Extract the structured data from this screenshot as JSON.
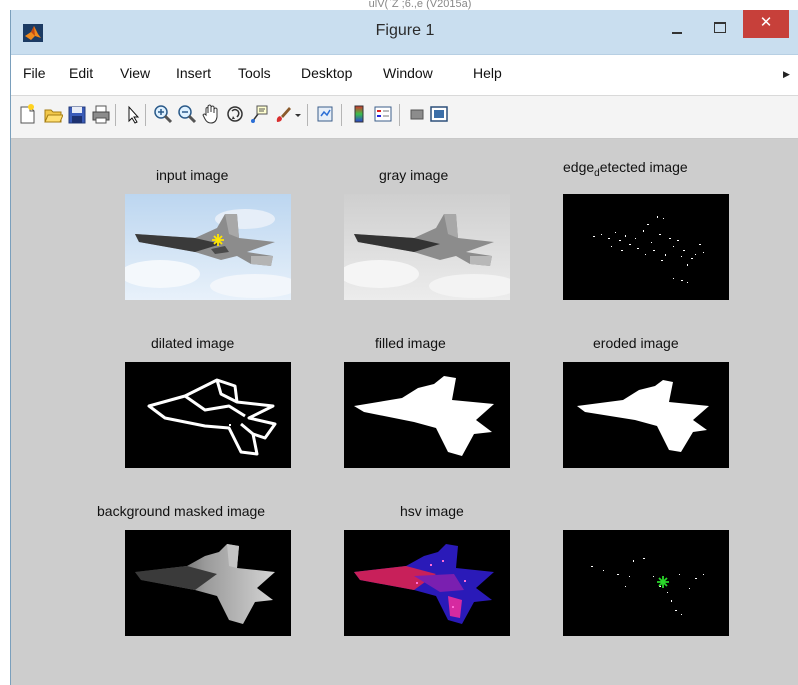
{
  "desktop": {
    "partial_title": "ulV(`Z ;6.,e (V2015a)"
  },
  "window": {
    "title": "Figure 1",
    "controls": {
      "close_glyph": "✕"
    }
  },
  "menu": [
    "File",
    "Edit",
    "View",
    "Insert",
    "Tools",
    "Desktop",
    "Window",
    "Help"
  ],
  "toolbar": {
    "icons": [
      "new-figure-icon",
      "open-file-icon",
      "save-icon",
      "print-icon",
      "edit-plot-icon",
      "zoom-in-icon",
      "zoom-out-icon",
      "pan-icon",
      "rotate-3d-icon",
      "data-cursor-icon",
      "brush-icon",
      "brush-dropdown-icon",
      "link-plot-icon",
      "colorbar-icon",
      "legend-icon",
      "hide-plot-tools-icon",
      "show-plot-tools-icon"
    ]
  },
  "axes": [
    {
      "title": "input image"
    },
    {
      "title": "gray image"
    },
    {
      "title_main": "edge",
      "title_sub": "d",
      "title_rest": "etected image"
    },
    {
      "title": "dilated image"
    },
    {
      "title": "filled image"
    },
    {
      "title": "eroded image"
    },
    {
      "title": "background masked image"
    },
    {
      "title": "hsv image"
    },
    {
      "title": ""
    }
  ],
  "colors": {
    "figure_bg": "#cdcdcd",
    "titlebar": "#c9deef",
    "close": "#c7403a",
    "centroid_marker_input": "#ffe600",
    "centroid_marker_edges": "#2ad62a"
  }
}
